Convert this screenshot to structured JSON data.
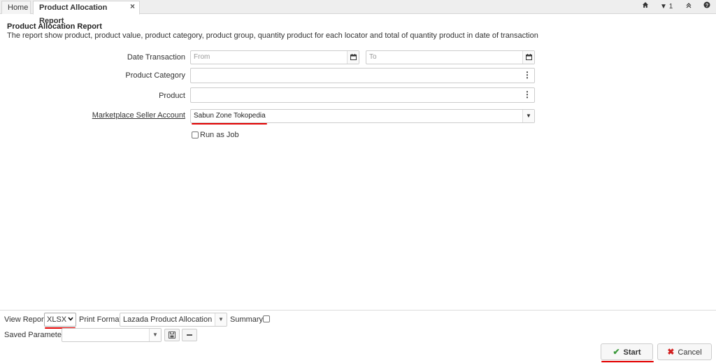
{
  "tabs": {
    "home": "Home",
    "active": "Product Allocation Report",
    "close_icon": "×"
  },
  "toolbar_right": {
    "home_icon": "home-icon",
    "notification_count": "1",
    "collapse_icon": "double-chevron-up-icon",
    "help_icon": "help-icon"
  },
  "header": {
    "title": "Product Allocation Report",
    "description": "The report show product, product value, product category, product group, quantity product for each locator and total of quantity product in date of transaction"
  },
  "form": {
    "date_label": "Date Transaction",
    "date_from_placeholder": "From",
    "date_to_placeholder": "To",
    "category_label": "Product Category",
    "category_value": "",
    "product_label": "Product",
    "product_value": "",
    "seller_label": "Marketplace Seller Account",
    "seller_value": "Sabun Zone Tokopedia",
    "run_as_job_label": "Run as Job",
    "run_as_job_checked": false
  },
  "footer": {
    "view_report_label": "View Report",
    "view_report_value": "XLSX",
    "print_format_label": "Print Format",
    "print_format_value": "Lazada Product Allocation Re",
    "summary_label": "Summary",
    "summary_checked": false,
    "saved_params_label": "Saved Parameters",
    "saved_params_value": "",
    "start_label": "Start",
    "cancel_label": "Cancel"
  },
  "colors": {
    "accent_underline": "#e30000",
    "start_check": "#3c9a3c",
    "cancel_x": "#d21f1f"
  }
}
